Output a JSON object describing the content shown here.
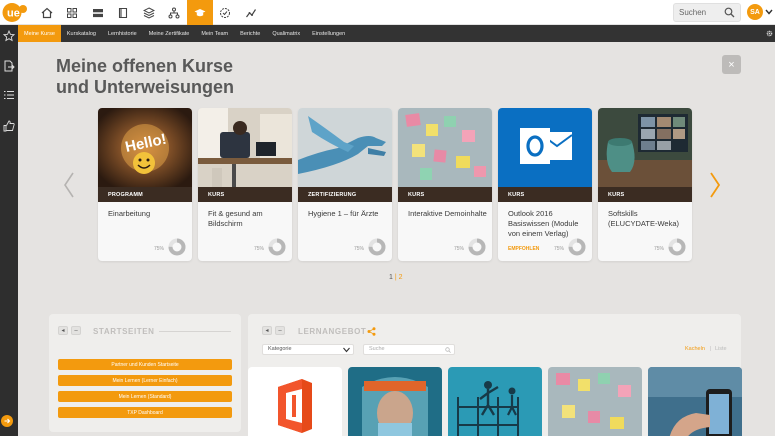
{
  "topbar": {
    "logo_text": "ue",
    "nav_icons": [
      "home-icon",
      "grid-icon",
      "list-icon",
      "book-icon",
      "layers-icon",
      "sitemap-icon",
      "graduation-cap-icon",
      "badge-check-icon",
      "chart-icon"
    ],
    "active_index": 6,
    "search_placeholder": "Suchen",
    "avatar_initials": "SA"
  },
  "subnav": {
    "items": [
      "Meine Kurse",
      "Kurskatalog",
      "Lernhistorie",
      "Meine Zertifikate",
      "Mein Team",
      "Berichte",
      "Qualimatrix",
      "Einstellungen"
    ],
    "active_index": 0
  },
  "rail_icons": [
    "star-icon",
    "file-export-icon",
    "checklist-icon",
    "thumbs-up-icon",
    "circle-arrow-icon"
  ],
  "main": {
    "title_line1": "Meine offenen Kurse",
    "title_line2": "und Unterweisungen",
    "close_label": "×",
    "cards": [
      {
        "type": "PROGRAMM",
        "title": "Einarbeitung",
        "percent": "75%",
        "recommended": "",
        "progress": 0.75
      },
      {
        "type": "KURS",
        "title": "Fit & gesund am Bildschirm",
        "percent": "75%",
        "recommended": "",
        "progress": 0.75
      },
      {
        "type": "ZERTIFIZIERUNG",
        "title": "Hygiene 1 – für Ärzte",
        "percent": "75%",
        "recommended": "",
        "progress": 0.75
      },
      {
        "type": "KURS",
        "title": "Interaktive Demoinhalte",
        "percent": "75%",
        "recommended": "",
        "progress": 0.75
      },
      {
        "type": "KURS",
        "title": "Outlook 2016 Basiswissen (Module von einem Verlag)",
        "percent": "75%",
        "recommended": "EMPFOHLEN",
        "progress": 0.75
      },
      {
        "type": "KURS",
        "title": "Softskills (ELUCYDATE-Weka)",
        "percent": "75%",
        "recommended": "",
        "progress": 0.75
      }
    ],
    "pager": {
      "page1": "1",
      "sep": "|",
      "page2": "2"
    }
  },
  "startseiten": {
    "title": "STARTSEITEN",
    "links": [
      "Partner und Kunden Startseite",
      "Mein Lernen (Lerner Einfach)",
      "Mein Lernen (Standard)",
      "TXP Dashboard"
    ]
  },
  "lernangebot": {
    "title": "LERNANGEBOT",
    "category_value": "Kategorie",
    "search_placeholder": "Suche",
    "view_tiles": "Kacheln",
    "view_sep": "|",
    "view_list": "Liste"
  },
  "colors": {
    "accent": "#f39a0e",
    "dark": "#333333",
    "card_band": "#3b2c22"
  }
}
